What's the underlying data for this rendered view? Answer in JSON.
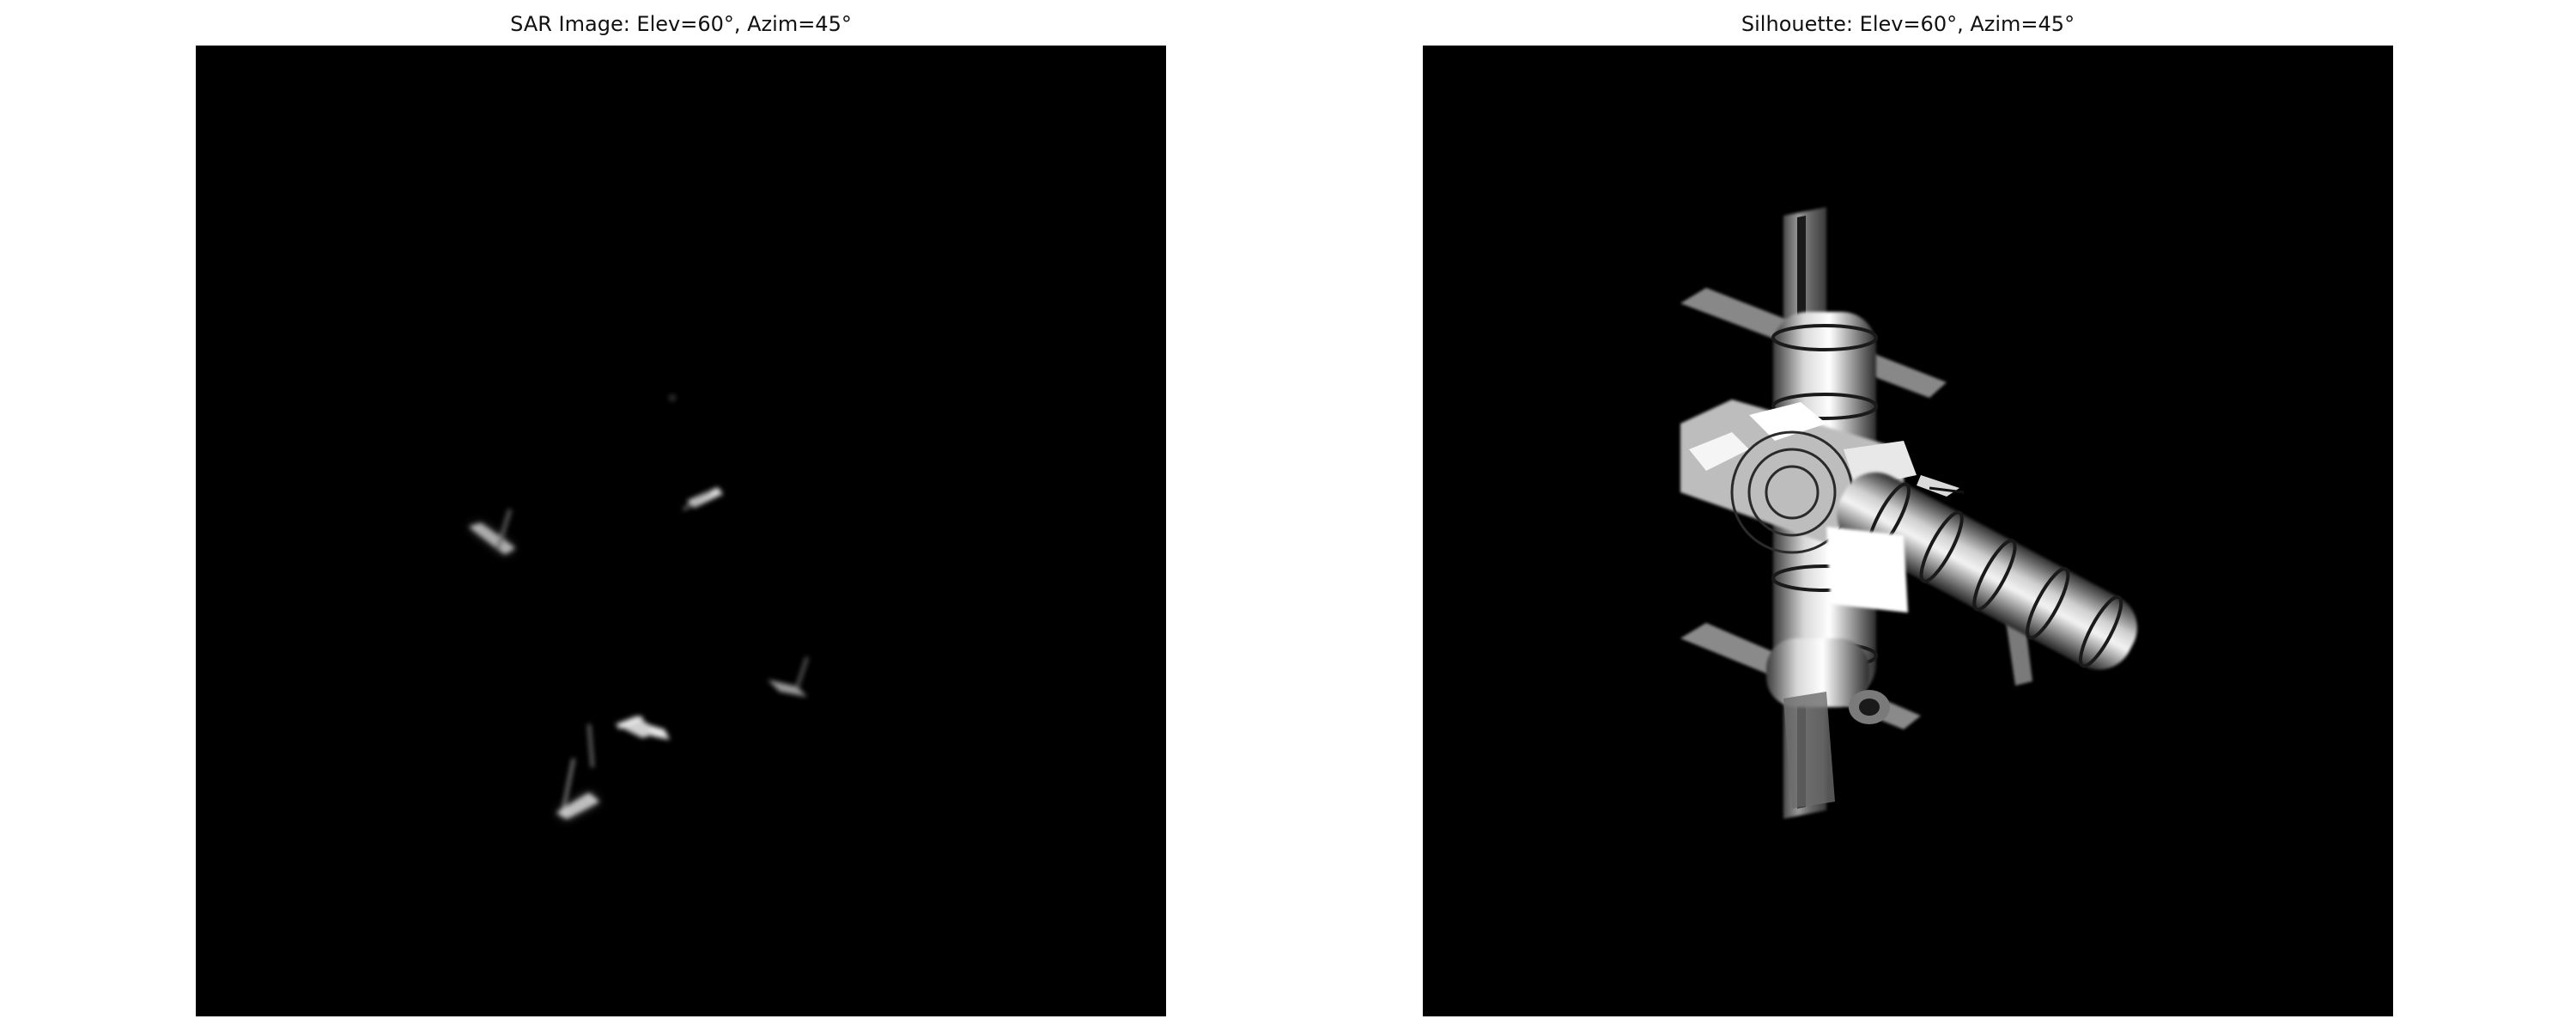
{
  "figure": {
    "panels": [
      {
        "title": "SAR Image: Elev=60°, Azim=45°"
      },
      {
        "title": "Silhouette: Elev=60°, Azim=45°"
      }
    ]
  }
}
